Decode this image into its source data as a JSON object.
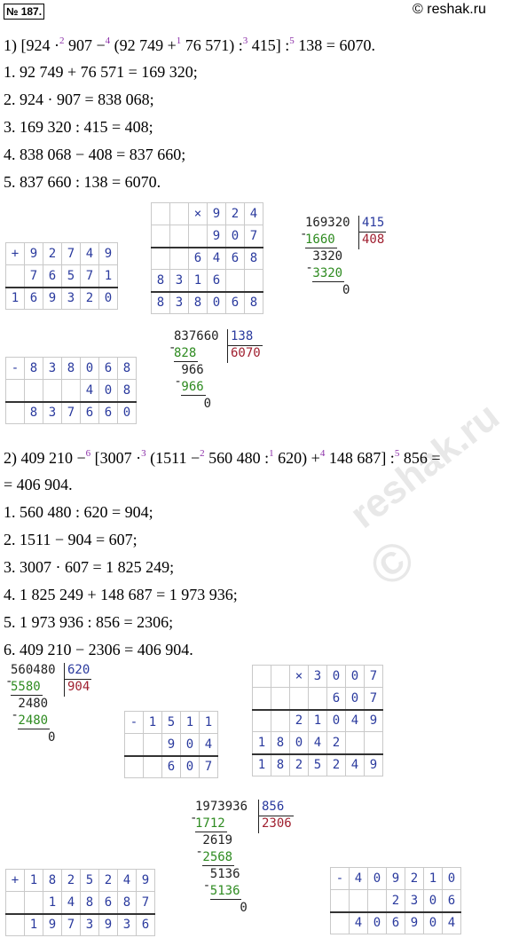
{
  "header": {
    "badge": "№ 187.",
    "site": "© reshak.ru"
  },
  "watermark": "reshak.ru",
  "part1": {
    "expr": [
      {
        "t": "1) [924 ·"
      },
      {
        "s": "2"
      },
      {
        "t": " 907 −"
      },
      {
        "s": "4"
      },
      {
        "t": " (92 749 +"
      },
      {
        "s": "1"
      },
      {
        "t": " 76 571) :"
      },
      {
        "s": "3"
      },
      {
        "t": " 415] :"
      },
      {
        "s": "5"
      },
      {
        "t": " 138 = 6070."
      }
    ],
    "steps": [
      "1.  92 749 + 76 571 = 169 320;",
      "2.  924 · 907 = 838 068;",
      "3.  169 320 : 415 = 408;",
      "4.  838 068 − 408 = 837 660;",
      "5.  837 660 : 138 = 6070."
    ]
  },
  "part2": {
    "expr": [
      {
        "t": "2) 409 210 −"
      },
      {
        "s": "6"
      },
      {
        "t": " [3007 ·"
      },
      {
        "s": "3"
      },
      {
        "t": " (1511 −"
      },
      {
        "s": "2"
      },
      {
        "t": " 560 480 :"
      },
      {
        "s": "1"
      },
      {
        "t": " 620) +"
      },
      {
        "s": "4"
      },
      {
        "t": " 148 687] :"
      },
      {
        "s": "5"
      },
      {
        "t": " 856 ="
      }
    ],
    "expr2": "= 406 904.",
    "steps": [
      "1.  560 480 : 620 = 904;",
      "2.  1511 − 904 = 607;",
      "3.  3007 · 607 = 1 825 249;",
      "4.  1 825 249 + 148 687 = 1 973 936;",
      "5.  1 973 936 : 856 = 2306;",
      "6.  409 210 − 2306 = 406 904."
    ]
  },
  "grids": [
    {
      "id": "add1",
      "rows": [
        [
          "+",
          "9",
          "2",
          "7",
          "4",
          "9"
        ],
        [
          "",
          "7",
          "6",
          "5",
          "7",
          "1"
        ],
        [
          "1",
          "6",
          "9",
          "3",
          "2",
          "0"
        ]
      ],
      "bar": [
        2
      ]
    },
    {
      "id": "mul1",
      "rows": [
        [
          "",
          "",
          "×",
          "9",
          "2",
          "4"
        ],
        [
          "",
          "",
          "",
          "9",
          "0",
          "7"
        ],
        [
          "",
          "",
          "6",
          "4",
          "6",
          "8"
        ],
        [
          "8",
          "3",
          "1",
          "6",
          "",
          ""
        ],
        [
          "8",
          "3",
          "8",
          "0",
          "6",
          "8"
        ]
      ],
      "bar": [
        2,
        4
      ]
    },
    {
      "id": "sub1",
      "rows": [
        [
          "-",
          "8",
          "3",
          "8",
          "0",
          "6",
          "8"
        ],
        [
          "",
          "",
          "",
          "",
          "4",
          "0",
          "8"
        ],
        [
          "",
          "8",
          "3",
          "7",
          "6",
          "6",
          "0"
        ]
      ],
      "bar": [
        2
      ]
    },
    {
      "id": "sub2",
      "rows": [
        [
          "-",
          "1",
          "5",
          "1",
          "1"
        ],
        [
          "",
          "",
          "9",
          "0",
          "4"
        ],
        [
          "",
          "",
          "6",
          "0",
          "7"
        ]
      ],
      "bar": [
        2
      ]
    },
    {
      "id": "mul2",
      "rows": [
        [
          "",
          "",
          "×",
          "3",
          "0",
          "0",
          "7"
        ],
        [
          "",
          "",
          "",
          "",
          "6",
          "0",
          "7"
        ],
        [
          "",
          "",
          "2",
          "1",
          "0",
          "4",
          "9"
        ],
        [
          "1",
          "8",
          "0",
          "4",
          "2",
          "",
          ""
        ],
        [
          "1",
          "8",
          "2",
          "5",
          "2",
          "4",
          "9"
        ]
      ],
      "bar": [
        2,
        4
      ]
    },
    {
      "id": "add2",
      "rows": [
        [
          "+",
          "1",
          "8",
          "2",
          "5",
          "2",
          "4",
          "9"
        ],
        [
          "",
          "",
          "1",
          "4",
          "8",
          "6",
          "8",
          "7"
        ],
        [
          "",
          "1",
          "9",
          "7",
          "3",
          "9",
          "3",
          "6"
        ]
      ],
      "bar": [
        2
      ]
    },
    {
      "id": "sub3",
      "rows": [
        [
          "-",
          "4",
          "0",
          "9",
          "2",
          "1",
          "0"
        ],
        [
          "",
          "",
          "",
          "2",
          "3",
          "0",
          "6"
        ],
        [
          "",
          "4",
          "0",
          "6",
          "9",
          "0",
          "4"
        ]
      ],
      "bar": [
        2
      ]
    }
  ],
  "divisions": [
    {
      "id": "div1",
      "dividend": "169320",
      "divisor": "415",
      "quotient": "408",
      "lines": [
        {
          "t": "1660",
          "c": "gr"
        },
        {
          "t": "3320",
          "c": "bk"
        },
        {
          "t": "3320",
          "c": "gr"
        },
        {
          "t": "0",
          "c": "bk"
        }
      ]
    },
    {
      "id": "div2",
      "dividend": "837660",
      "divisor": "138",
      "quotient": "6070",
      "lines": [
        {
          "t": "828",
          "c": "gr"
        },
        {
          "t": "966",
          "c": "bk"
        },
        {
          "t": "966",
          "c": "gr"
        },
        {
          "t": "0",
          "c": "bk"
        }
      ]
    },
    {
      "id": "div3",
      "dividend": "560480",
      "divisor": "620",
      "quotient": "904",
      "lines": [
        {
          "t": "5580",
          "c": "gr"
        },
        {
          "t": "2480",
          "c": "bk"
        },
        {
          "t": "2480",
          "c": "gr"
        },
        {
          "t": "0",
          "c": "bk"
        }
      ]
    },
    {
      "id": "div4",
      "dividend": "1973936",
      "divisor": "856",
      "quotient": "2306",
      "lines": [
        {
          "t": "1712",
          "c": "gr"
        },
        {
          "t": "2619",
          "c": "bk"
        },
        {
          "t": "2568",
          "c": "gr"
        },
        {
          "t": "5136",
          "c": "bk"
        },
        {
          "t": "5136",
          "c": "gr"
        },
        {
          "t": "0",
          "c": "bk"
        }
      ]
    }
  ]
}
